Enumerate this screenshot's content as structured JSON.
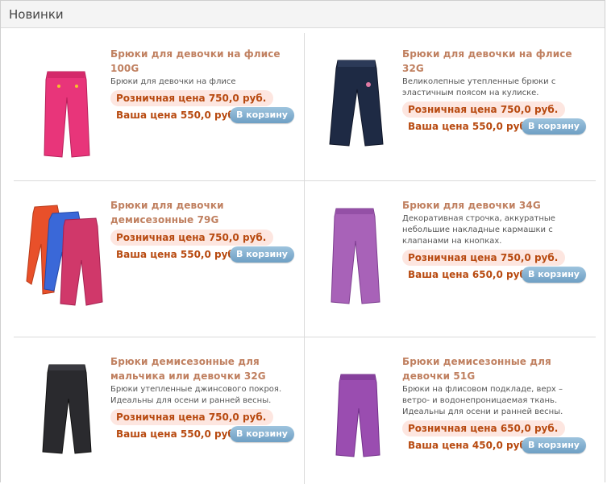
{
  "header": {
    "title": "Новинки"
  },
  "products": [
    {
      "title": "Брюки для девочки на флисе 100G",
      "description": "Брюки для девочки на флисе",
      "retail_price": "Розничная цена 750,0 руб.",
      "your_price": "Ваша цена 550,0 руб.",
      "cart_label": "В корзину",
      "colors": {
        "pants": "#e8357a"
      }
    },
    {
      "title": "Брюки для девочки на флисе 32G",
      "description": "Великолепные утепленные брюки с эластичным поясом на кулиске.",
      "retail_price": "Розничная цена 750,0 руб.",
      "your_price": "Ваша цена 550,0 руб.",
      "cart_label": "В корзину",
      "colors": {
        "pants": "#1e2a44"
      }
    },
    {
      "title": "Брюки для девочки демисезонные 79G",
      "description": "",
      "retail_price": "Розничная цена 750,0 руб.",
      "your_price": "Ваша цена 550,0 руб.",
      "cart_label": "В корзину",
      "colors": {
        "pants": "#d0386a"
      }
    },
    {
      "title": "Брюки для девочки 34G",
      "description": "Декоративная строчка, аккуратные небольшие накладные кармашки с клапанами на кнопках.",
      "retail_price": "Розничная цена 750,0 руб.",
      "your_price": "Ваша цена 650,0 руб.",
      "cart_label": "В корзину",
      "colors": {
        "pants": "#a862b8"
      }
    },
    {
      "title": "Брюки демисезонные для мальчика или девочки 32G",
      "description": "Брюки утепленные джинсового покроя. Идеальны для осени и ранней весны.",
      "retail_price": "Розничная цена 750,0 руб.",
      "your_price": "Ваша цена 550,0 руб.",
      "cart_label": "В корзину",
      "colors": {
        "pants": "#2a2a2e"
      }
    },
    {
      "title": "Брюки демисезонные для девочки 51G",
      "description": "Брюки на флисовом подкладе, верх – ветро- и водонепроницаемая ткань. Идеальны для осени и ранней весны.",
      "retail_price": "Розничная цена 650,0 руб.",
      "your_price": "Ваша цена 450,0 руб.",
      "cart_label": "В корзину",
      "colors": {
        "pants": "#9a4db0"
      }
    }
  ]
}
